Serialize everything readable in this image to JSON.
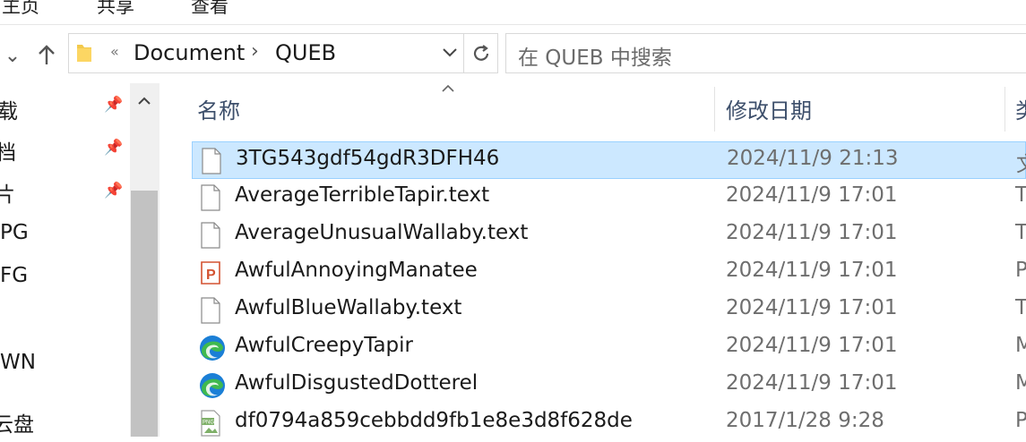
{
  "ribbon": {
    "tabs": [
      "主页",
      "共享",
      "查看"
    ]
  },
  "navigation": {
    "back_icon": "chevron-down-icon",
    "up_icon": "arrow-up-icon"
  },
  "address_bar": {
    "overflow": "«",
    "crumbs": [
      "Document",
      "QUEB"
    ],
    "separator": "›"
  },
  "search": {
    "placeholder": "在 QUEB 中搜索"
  },
  "sidebar": {
    "items": [
      "载",
      "档",
      "片",
      "PG",
      "FG",
      "WN",
      "云盘"
    ],
    "pins": [
      "pin-icon",
      "pin-icon",
      "pin-icon"
    ]
  },
  "columns": {
    "name": "名称",
    "modified": "修改日期",
    "type": "类"
  },
  "files": [
    {
      "name": "3TG543gdf54gdR3DFH46",
      "modified": "2024/11/9 21:13",
      "type": "文",
      "icon": "file-icon",
      "selected": true
    },
    {
      "name": "AverageTerribleTapir.text",
      "modified": "2024/11/9 17:01",
      "type": "T",
      "icon": "file-icon"
    },
    {
      "name": "AverageUnusualWallaby.text",
      "modified": "2024/11/9 17:01",
      "type": "T",
      "icon": "file-icon"
    },
    {
      "name": "AwfulAnnoyingManatee",
      "modified": "2024/11/9 17:01",
      "type": "P",
      "icon": "powerpoint-icon"
    },
    {
      "name": "AwfulBlueWallaby.text",
      "modified": "2024/11/9 17:01",
      "type": "T",
      "icon": "file-icon"
    },
    {
      "name": "AwfulCreepyTapir",
      "modified": "2024/11/9 17:01",
      "type": "M",
      "icon": "edge-icon"
    },
    {
      "name": "AwfulDisgustedDotterel",
      "modified": "2024/11/9 17:01",
      "type": "M",
      "icon": "edge-icon"
    },
    {
      "name": "df0794a859cebbdd9fb1e8e3d8f628de",
      "modified": "2017/1/28 9:28",
      "type": "P",
      "icon": "png-icon"
    }
  ],
  "colors": {
    "selection": "#cce8ff",
    "selection_border": "#99d1ff",
    "header_text": "#3d4f6b",
    "edge_blue": "#1b7fd6",
    "edge_green": "#3fb94f",
    "ppt_orange": "#d35230"
  }
}
